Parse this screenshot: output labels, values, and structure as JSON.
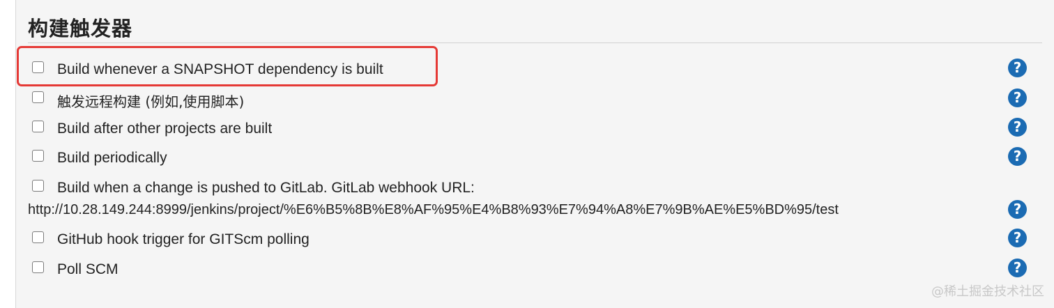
{
  "section": {
    "title": "构建触发器"
  },
  "triggers": [
    {
      "label": "Build whenever a SNAPSHOT dependency is built",
      "checked": false
    },
    {
      "label": "触发远程构建 (例如,使用脚本)",
      "checked": false
    },
    {
      "label": "Build after other projects are built",
      "checked": false
    },
    {
      "label": "Build periodically",
      "checked": false
    },
    {
      "label": "Build when a change is pushed to GitLab. GitLab webhook URL:",
      "url": "http://10.28.149.244:8999/jenkins/project/%E6%B5%8B%E8%AF%95%E4%B8%93%E7%94%A8%E7%9B%AE%E5%BD%95/test",
      "checked": false
    },
    {
      "label": "GitHub hook trigger for GITScm polling",
      "checked": false
    },
    {
      "label": "Poll SCM",
      "checked": false
    }
  ],
  "help": {
    "glyph": "?"
  },
  "watermark": "@稀土掘金技术社区",
  "colors": {
    "highlight": "#e53935",
    "help_icon": "#1b6bb3",
    "panel_bg": "#f5f5f5"
  }
}
